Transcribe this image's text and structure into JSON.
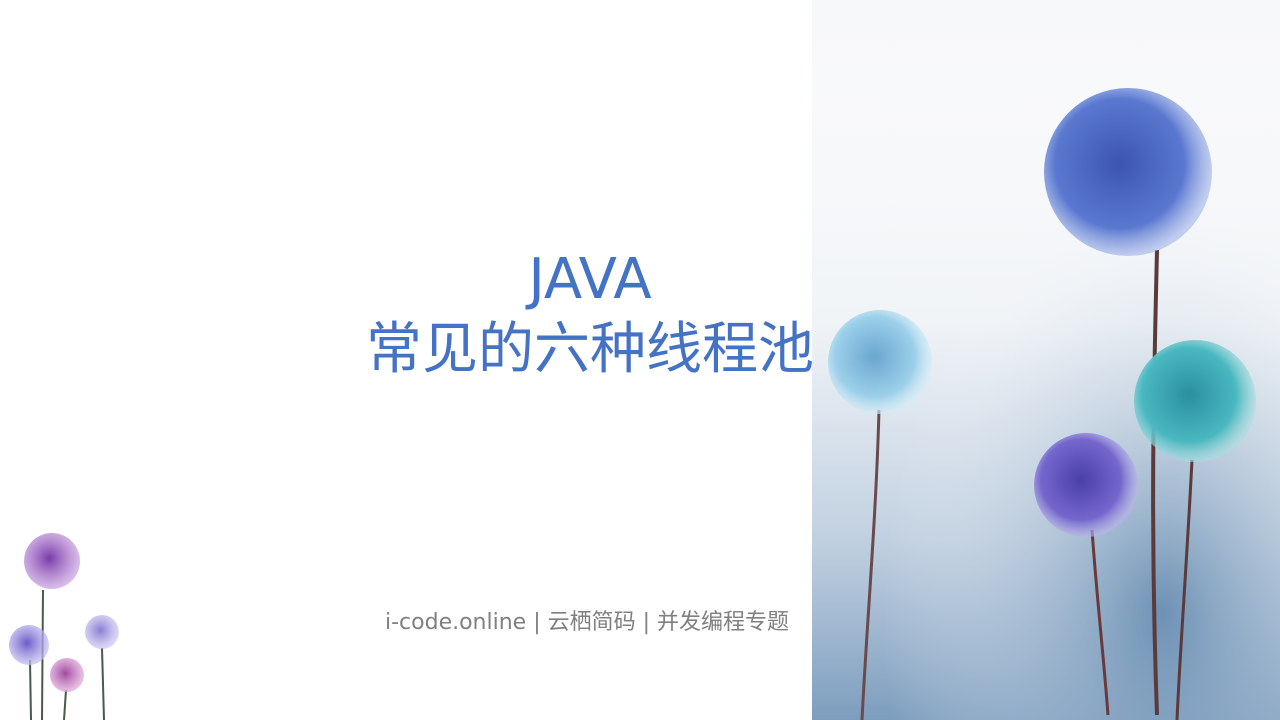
{
  "title": {
    "line1": "JAVA",
    "line2": "常见的六种线程池"
  },
  "footer": {
    "text": "i-code.online | 云栖简码 | 并发编程专题"
  },
  "colors": {
    "title": "#4472c4",
    "footer": "#808080",
    "watercolor": "#6f93b8",
    "flower_blue": "#4a64c8",
    "flower_light_blue": "#8fc4e0",
    "flower_teal": "#3fa8b0",
    "flower_purple": "#6a5cc8",
    "flower_violet": "#9a4cc0",
    "flower_pink": "#c060b0",
    "stem": "#5a3a3a"
  },
  "icons": {
    "decoration_right": "dandelion-flowers-watercolor",
    "decoration_left": "small-dandelion-flowers"
  }
}
